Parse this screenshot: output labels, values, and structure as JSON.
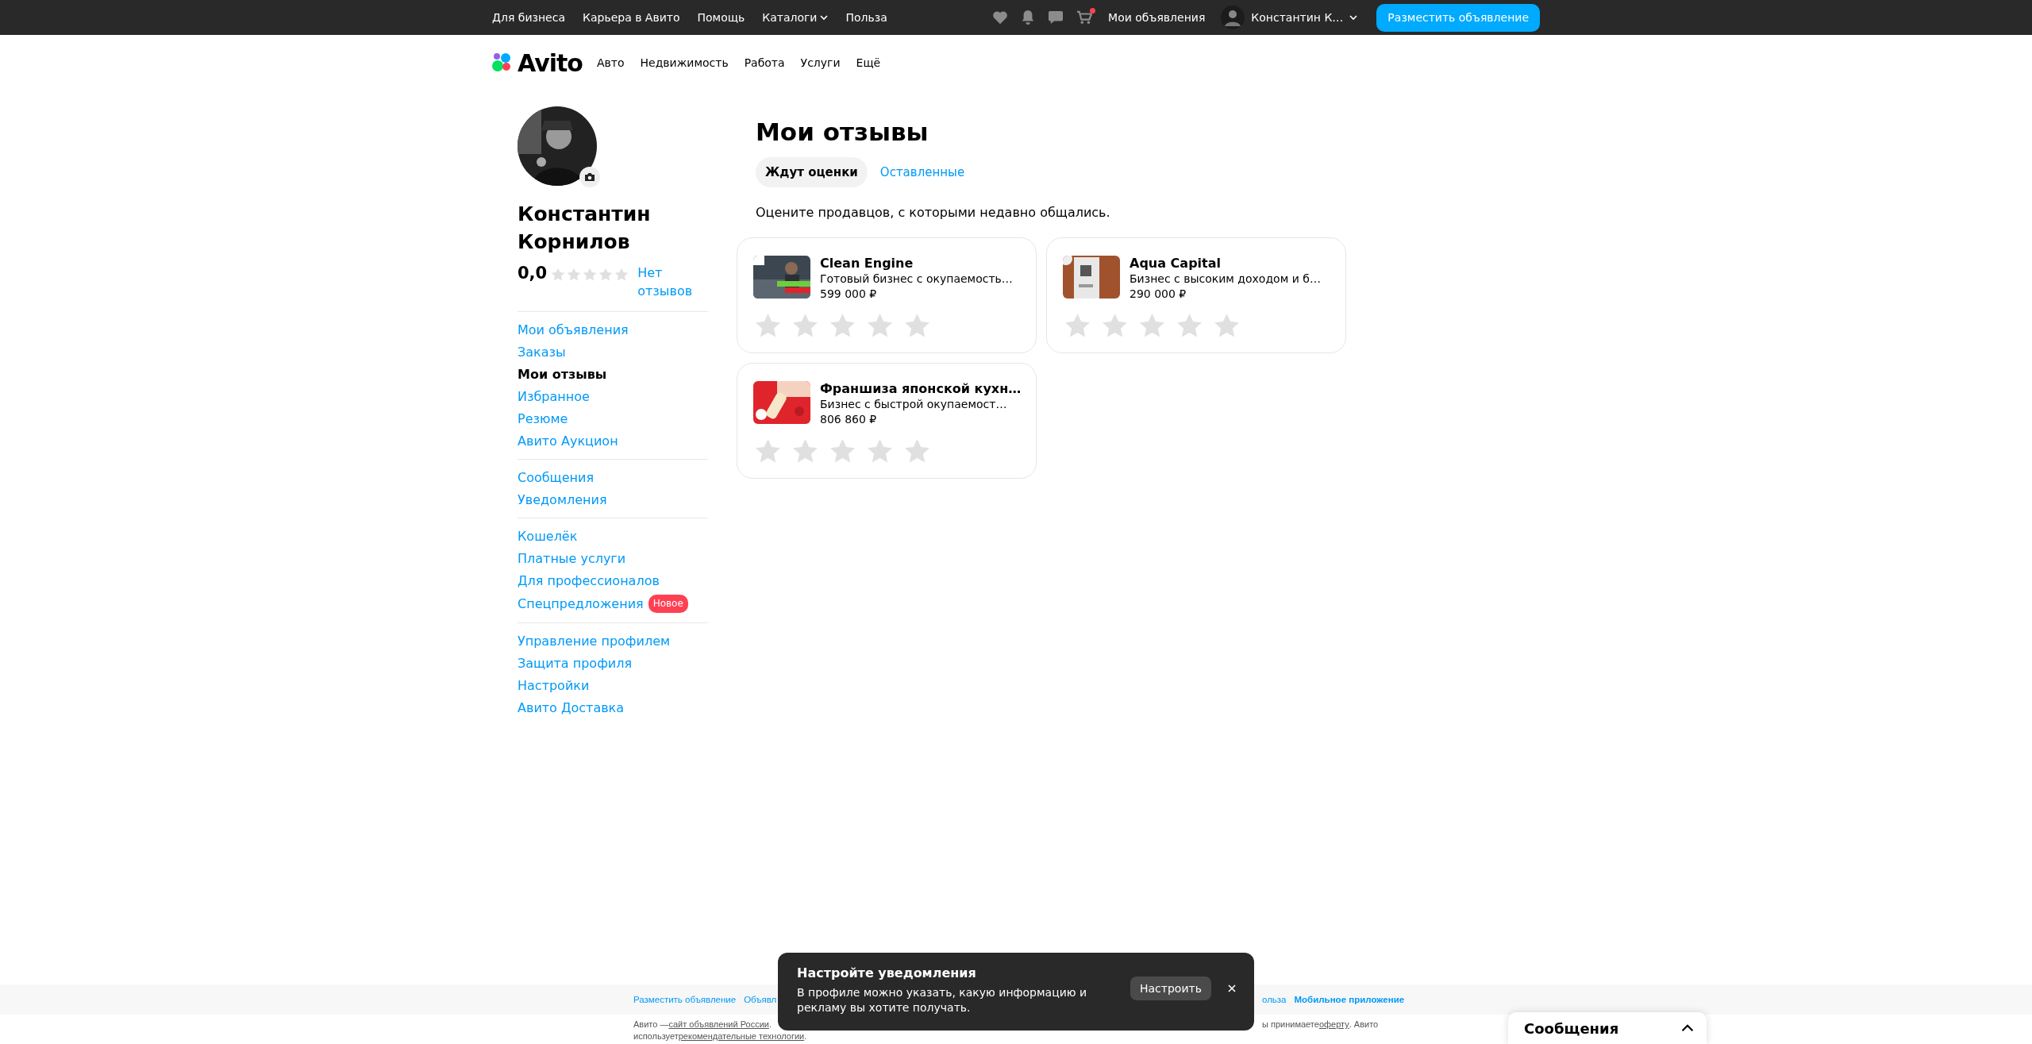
{
  "top_bar": {
    "links": [
      {
        "label": "Для бизнеса",
        "kind": "link"
      },
      {
        "label": "Карьера в Авито",
        "kind": "link"
      },
      {
        "label": "Помощь",
        "kind": "link"
      },
      {
        "label": "Каталоги",
        "kind": "dropdown"
      },
      {
        "label": "Польза",
        "kind": "link"
      }
    ],
    "cart_unread": true,
    "my_ads": "Мои объявления",
    "user_name": "Константин К…",
    "post_button": "Разместить объявление"
  },
  "header": {
    "logo": "Avito",
    "nav": [
      "Авто",
      "Недвижимость",
      "Работа",
      "Услуги",
      "Ещё"
    ]
  },
  "profile": {
    "name": "Константин Корнилов",
    "rating": "0,0",
    "stars": 0,
    "reviews_link": "Нет отзывов"
  },
  "menu": [
    [
      {
        "label": "Мои объявления",
        "selected": false
      },
      {
        "label": "Заказы",
        "selected": false
      },
      {
        "label": "Мои отзывы",
        "selected": true
      },
      {
        "label": "Избранное",
        "selected": false
      },
      {
        "label": "Резюме",
        "selected": false
      },
      {
        "label": "Авито Аукцион",
        "selected": false
      }
    ],
    [
      {
        "label": "Сообщения",
        "selected": false
      },
      {
        "label": "Уведомления",
        "selected": false
      }
    ],
    [
      {
        "label": "Кошелёк",
        "selected": false
      },
      {
        "label": "Платные услуги",
        "selected": false
      },
      {
        "label": "Для профессионалов",
        "selected": false
      },
      {
        "label": "Спецпредложения",
        "selected": false,
        "badge": "Новое"
      }
    ],
    [
      {
        "label": "Управление профилем",
        "selected": false
      },
      {
        "label": "Защита профиля",
        "selected": false
      },
      {
        "label": "Настройки",
        "selected": false
      },
      {
        "label": "Авито Доставка",
        "selected": false
      }
    ]
  ],
  "page": {
    "title": "Мои отзывы",
    "tabs": [
      {
        "label": "Ждут оценки",
        "selected": true
      },
      {
        "label": "Оставленные",
        "selected": false
      }
    ],
    "hint": "Оцените продавцов, с которыми недавно общались."
  },
  "cards": [
    {
      "title": "Clean Engine",
      "subtitle": "Готовый бизнес с окупаемость…",
      "price": "599 000 ₽",
      "stars": 0,
      "kind": "picture"
    },
    {
      "title": "Aqua Capital",
      "subtitle": "Бизнес с высоким доходом и б…",
      "price": "290 000 ₽",
      "stars": 0,
      "kind": "picture"
    },
    {
      "title": "Франшиза японской кухн…",
      "subtitle": "Бизнес с быстрой окупаемост…",
      "price": "806 860 ₽",
      "stars": 0,
      "kind": "picture"
    }
  ],
  "footer": {
    "links_left": [
      "Разместить объявление",
      "Объявл"
    ],
    "links_right": [
      {
        "label": "ольза",
        "bold": false
      },
      {
        "label": "Мобильное приложение",
        "bold": true
      }
    ],
    "legal_left": {
      "before": "Авито — ",
      "link": "сайт объявлений России",
      "after": "."
    },
    "legal_right": {
      "before": "ы принимаете ",
      "link": "оферту",
      "after": ". Авито"
    },
    "legal_line2": {
      "before": "использует ",
      "link": "рекомендательные технологии",
      "after": "."
    }
  },
  "toast": {
    "title": "Настройте уведомления",
    "text": "В профиле можно указать, какую информацию и рекламу вы хотите получать.",
    "button": "Настроить"
  },
  "messages_panel": {
    "title": "Сообщения",
    "expanded": false
  }
}
